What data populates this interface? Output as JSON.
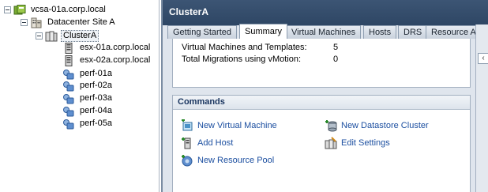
{
  "tree": {
    "vcenter": "vcsa-01a.corp.local",
    "datacenter": "Datacenter Site A",
    "cluster": "ClusterA",
    "hosts": [
      "esx-01a.corp.local",
      "esx-02a.corp.local"
    ],
    "pools": [
      "perf-01a",
      "perf-02a",
      "perf-03a",
      "perf-04a",
      "perf-05a"
    ]
  },
  "header": {
    "title": "ClusterA"
  },
  "tabs": [
    "Getting Started",
    "Summary",
    "Virtual Machines",
    "Hosts",
    "DRS",
    "Resource Allocation"
  ],
  "active_tab": "Summary",
  "stats": [
    {
      "label": "Virtual Machines and Templates:",
      "value": "5"
    },
    {
      "label": "Total Migrations using vMotion:",
      "value": "0"
    }
  ],
  "commands": {
    "title": "Commands",
    "items": [
      "New Virtual Machine",
      "Add Host",
      "New Resource Pool",
      "New Datastore Cluster",
      "Edit Settings"
    ]
  },
  "colors": {
    "header_bg": "#2e4664",
    "link": "#1c4fa0",
    "commands_title": "#17335e"
  }
}
